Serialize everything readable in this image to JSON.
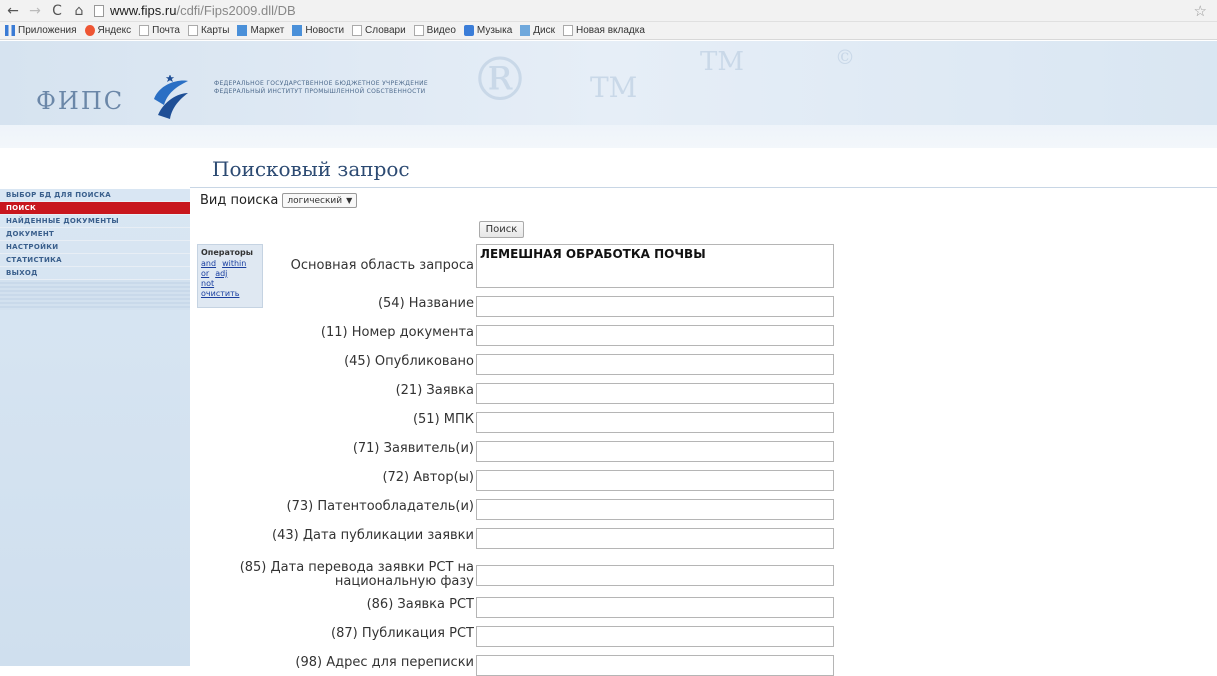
{
  "browser": {
    "url_host": "www.fips.ru",
    "url_path": "/cdfi/Fips2009.dll/DB",
    "bookmarks": [
      "Приложения",
      "Яндекс",
      "Почта",
      "Карты",
      "Маркет",
      "Новости",
      "Словари",
      "Видео",
      "Музыка",
      "Диск",
      "Новая вкладка"
    ]
  },
  "header": {
    "logo": "ФИПС",
    "org_line1": "ФЕДЕРАЛЬНОЕ ГОСУДАРСТВЕННОЕ БЮДЖЕТНОЕ УЧРЕЖДЕНИЕ",
    "org_line2": "ФЕДЕРАЛЬНЫЙ ИНСТИТУТ ПРОМЫШЛЕННОЙ СОБСТВЕННОСТИ"
  },
  "menu": {
    "items": [
      {
        "label": "ВЫБОР БД ДЛЯ ПОИСКА",
        "active": false
      },
      {
        "label": "ПОИСК",
        "active": true
      },
      {
        "label": "НАЙДЕННЫЕ ДОКУМЕНТЫ",
        "active": false
      },
      {
        "label": "ДОКУМЕНТ",
        "active": false
      },
      {
        "label": "НАСТРОЙКИ",
        "active": false
      },
      {
        "label": "СТАТИСТИКА",
        "active": false
      },
      {
        "label": "ВЫХОД",
        "active": false
      }
    ]
  },
  "page_title": "Поисковый запрос",
  "form": {
    "search_kind_label": "Вид поиска",
    "search_kind_value": "логический",
    "search_button": "Поиск",
    "operators": {
      "title": "Операторы",
      "items": [
        "and",
        "within",
        "or",
        "adj",
        "not",
        "очистить"
      ]
    },
    "main_field_label": "Основная область запроса",
    "main_field_value": "ЛЕМЕШНАЯ ОБРАБОТКА ПОЧВЫ",
    "fields": [
      "(54) Название",
      "(11) Номер документа",
      "(45) Опубликовано",
      "(21) Заявка",
      "(51) МПК",
      "(71) Заявитель(и)",
      "(72) Автор(ы)",
      "(73) Патентообладатель(и)",
      "(43) Дата публикации заявки",
      "(85) Дата перевода заявки PCT на национальную фазу",
      "(86) Заявка PCT",
      "(87) Публикация PCT",
      "(98) Адрес для переписки"
    ]
  }
}
